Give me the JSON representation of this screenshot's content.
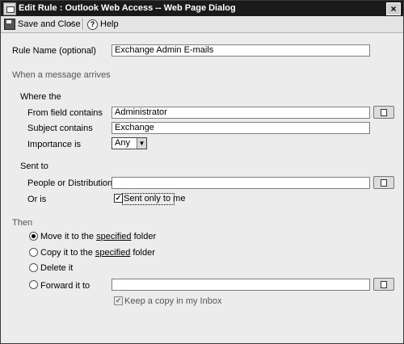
{
  "window": {
    "title": "Edit Rule : Outlook Web Access -- Web Page Dialog",
    "close_glyph": "×"
  },
  "toolbar": {
    "save_close_label": "Save and Close",
    "help_label": "Help"
  },
  "rule": {
    "name_label": "Rule Name  (optional)",
    "name_value": "Exchange Admin E-mails"
  },
  "conditions": {
    "section_label": "When a message arrives",
    "where_label": "Where the",
    "from_label": "From field contains",
    "from_value": "Administrator",
    "subject_label": "Subject contains",
    "subject_value": "Exchange",
    "importance_label": "Importance is",
    "importance_value": "Any",
    "sent_to_label": "Sent to",
    "people_label": "People or Distribution List",
    "people_value": "",
    "or_is_label": "Or is",
    "sent_only_label": "Sent only to me",
    "sent_only_checked": true
  },
  "actions": {
    "then_label": "Then",
    "move_prefix": "Move it to the",
    "move_link": "specified",
    "move_suffix": "folder",
    "copy_prefix": "Copy it to the",
    "copy_link": "specified",
    "copy_suffix": "folder",
    "delete_label": "Delete it",
    "forward_label": "Forward it to",
    "forward_value": "",
    "keep_copy_label": "Keep a copy in my Inbox",
    "keep_copy_checked": true,
    "selected": "move"
  }
}
